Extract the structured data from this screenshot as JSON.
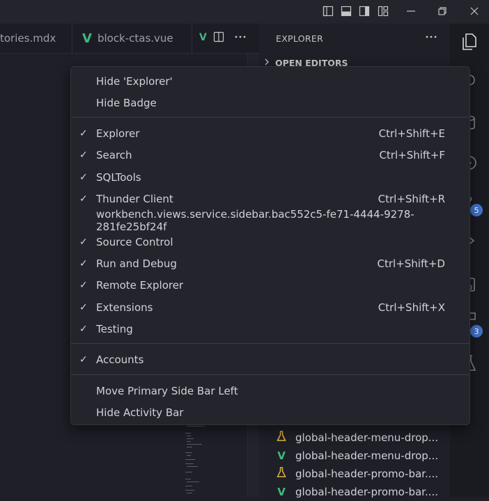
{
  "window": {
    "colors": {
      "accent": "#3f72c8",
      "vue_green": "#41b883",
      "flask_yellow": "#e2b43c"
    }
  },
  "tabs": [
    {
      "label": "tories.mdx",
      "icon": "mdx-file"
    },
    {
      "label": "block-ctas.vue",
      "icon": "vue-icon"
    }
  ],
  "explorer": {
    "title": "EXPLORER",
    "open_editors": "OPEN EDITORS",
    "files": [
      {
        "label": "global-header-menu-drop...",
        "icon": "flask-icon"
      },
      {
        "label": "global-header-menu-drop...",
        "icon": "vue-icon"
      },
      {
        "label": "global-header-promo-bar....",
        "icon": "flask-icon"
      },
      {
        "label": "global-header-promo-bar....",
        "icon": "vue-icon"
      }
    ]
  },
  "activity_badges": {
    "source_control": "5",
    "extensions": "3"
  },
  "context_menu": {
    "group1": [
      {
        "label": "Hide 'Explorer'"
      },
      {
        "label": "Hide Badge"
      }
    ],
    "group2": [
      {
        "label": "Explorer",
        "checked": true,
        "shortcut": "Ctrl+Shift+E"
      },
      {
        "label": "Search",
        "checked": true,
        "shortcut": "Ctrl+Shift+F"
      },
      {
        "label": "SQLTools",
        "checked": true,
        "shortcut": ""
      },
      {
        "label": "Thunder Client",
        "checked": true,
        "shortcut": "Ctrl+Shift+R"
      },
      {
        "label": "workbench.views.service.sidebar.bac552c5-fe71-4444-9278-281fe25bf24f",
        "checked": false,
        "shortcut": ""
      },
      {
        "label": "Source Control",
        "checked": true,
        "shortcut": ""
      },
      {
        "label": "Run and Debug",
        "checked": true,
        "shortcut": "Ctrl+Shift+D"
      },
      {
        "label": "Remote Explorer",
        "checked": true,
        "shortcut": ""
      },
      {
        "label": "Extensions",
        "checked": true,
        "shortcut": "Ctrl+Shift+X"
      },
      {
        "label": "Testing",
        "checked": true,
        "shortcut": ""
      }
    ],
    "group3": [
      {
        "label": "Accounts",
        "checked": true
      }
    ],
    "group4": [
      {
        "label": "Move Primary Side Bar Left"
      },
      {
        "label": "Hide Activity Bar"
      }
    ]
  }
}
